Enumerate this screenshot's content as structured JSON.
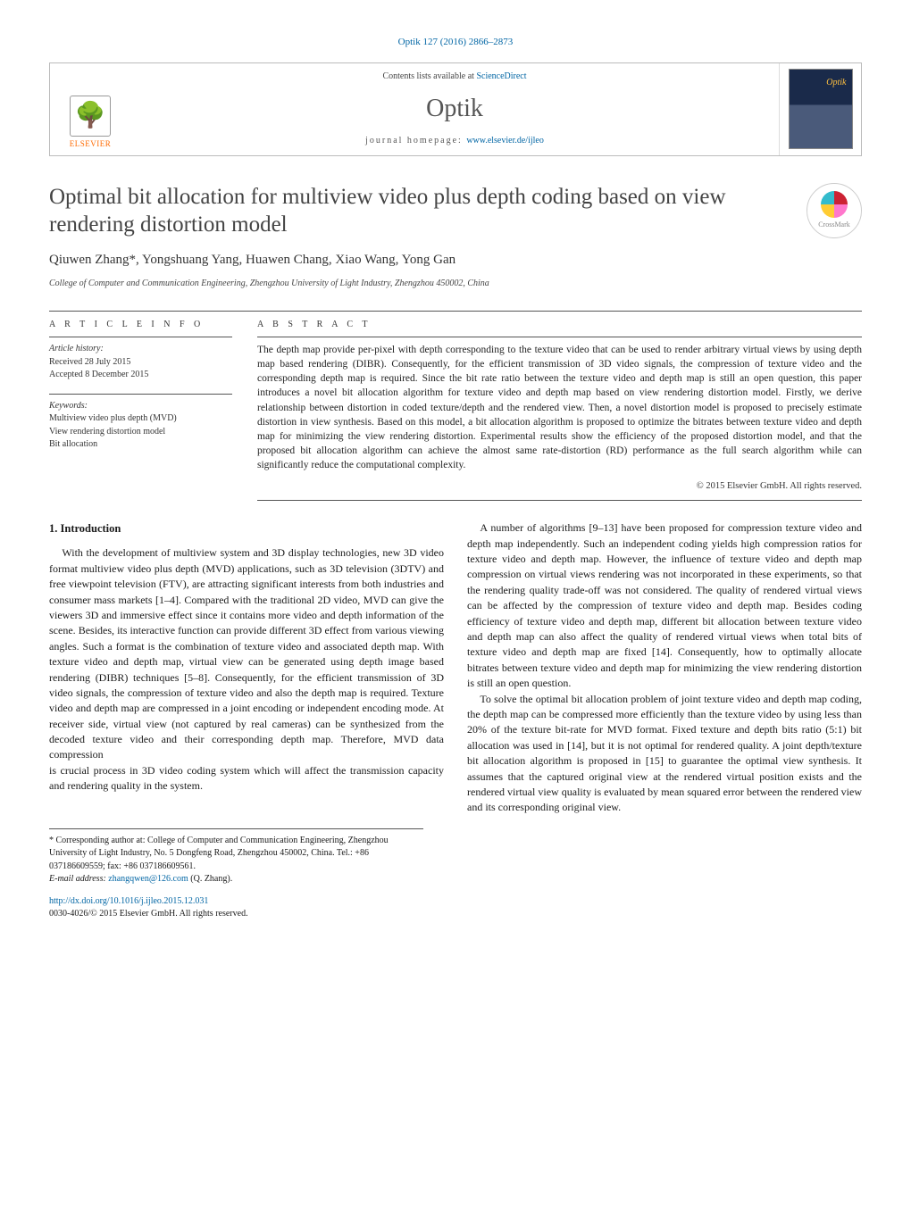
{
  "citation": "Optik 127 (2016) 2866–2873",
  "contents_prefix": "Contents lists available at ",
  "contents_link": "ScienceDirect",
  "journal": "Optik",
  "homepage_label": "journal homepage: ",
  "homepage_url": "www.elsevier.de/ijleo",
  "publisher": "ELSEVIER",
  "crossmark": "CrossMark",
  "title": "Optimal bit allocation for multiview video plus depth coding based on view rendering distortion model",
  "authors": "Qiuwen Zhang*, Yongshuang Yang, Huawen Chang, Xiao Wang, Yong Gan",
  "affiliation": "College of Computer and Communication Engineering, Zhengzhou University of Light Industry, Zhengzhou 450002, China",
  "info_heading": "A R T I C L E  I N F O",
  "abstract_heading": "A B S T R A C T",
  "history_label": "Article history:",
  "history_received": "Received 28 July 2015",
  "history_accepted": "Accepted 8 December 2015",
  "keywords_label": "Keywords:",
  "keywords": [
    "Multiview video plus depth (MVD)",
    "View rendering distortion model",
    "Bit allocation"
  ],
  "abstract": "The depth map provide per-pixel with depth corresponding to the texture video that can be used to render arbitrary virtual views by using depth map based rendering (DIBR). Consequently, for the efficient transmission of 3D video signals, the compression of texture video and the corresponding depth map is required. Since the bit rate ratio between the texture video and depth map is still an open question, this paper introduces a novel bit allocation algorithm for texture video and depth map based on view rendering distortion model. Firstly, we derive relationship between distortion in coded texture/depth and the rendered view. Then, a novel distortion model is proposed to precisely estimate distortion in view synthesis. Based on this model, a bit allocation algorithm is proposed to optimize the bitrates between texture video and depth map for minimizing the view rendering distortion. Experimental results show the efficiency of the proposed distortion model, and that the proposed bit allocation algorithm can achieve the almost same rate-distortion (RD) performance as the full search algorithm while can significantly reduce the computational complexity.",
  "copyright": "© 2015 Elsevier GmbH. All rights reserved.",
  "section1_heading": "1.  Introduction",
  "body_p1": "With the development of multiview system and 3D display technologies, new 3D video format multiview video plus depth (MVD) applications, such as 3D television (3DTV) and free viewpoint television (FTV), are attracting significant interests from both industries and consumer mass markets [1–4]. Compared with the traditional 2D video, MVD can give the viewers 3D and immersive effect since it contains more video and depth information of the scene. Besides, its interactive function can provide different 3D effect from various viewing angles. Such a format is the combination of texture video and associated depth map. With texture video and depth map, virtual view can be generated using depth image based rendering (DIBR) techniques [5–8]. Consequently, for the efficient transmission of 3D video signals, the compression of texture video and also the depth map is required. Texture video and depth map are compressed in a joint encoding or independent encoding mode. At receiver side, virtual view (not captured by real cameras) can be synthesized from the decoded texture video and their corresponding depth map. Therefore, MVD data compression",
  "body_p2": "is crucial process in 3D video coding system which will affect the transmission capacity and rendering quality in the system.",
  "body_p3": "A number of algorithms [9–13] have been proposed for compression texture video and depth map independently. Such an independent coding yields high compression ratios for texture video and depth map. However, the influence of texture video and depth map compression on virtual views rendering was not incorporated in these experiments, so that the rendering quality trade-off was not considered. The quality of rendered virtual views can be affected by the compression of texture video and depth map. Besides coding efficiency of texture video and depth map, different bit allocation between texture video and depth map can also affect the quality of rendered virtual views when total bits of texture video and depth map are fixed [14]. Consequently, how to optimally allocate bitrates between texture video and depth map for minimizing the view rendering distortion is still an open question.",
  "body_p4": "To solve the optimal bit allocation problem of joint texture video and depth map coding, the depth map can be compressed more efficiently than the texture video by using less than 20% of the texture bit-rate for MVD format. Fixed texture and depth bits ratio (5:1) bit allocation was used in [14], but it is not optimal for rendered quality. A joint depth/texture bit allocation algorithm is proposed in [15] to guarantee the optimal view synthesis. It assumes that the captured original view at the rendered virtual position exists and the rendered virtual view quality is evaluated by mean squared error between the rendered view and its corresponding original view.",
  "footnote_corr": "* Corresponding author at: College of Computer and Communication Engineering, Zhengzhou University of Light Industry, No. 5 Dongfeng Road, Zhengzhou 450002, China. Tel.: +86 037186609559; fax: +86 037186609561.",
  "footnote_email_label": "E-mail address: ",
  "footnote_email": "zhangqwen@126.com",
  "footnote_email_who": " (Q. Zhang).",
  "doi": "http://dx.doi.org/10.1016/j.ijleo.2015.12.031",
  "issn_line": "0030-4026/© 2015 Elsevier GmbH. All rights reserved."
}
